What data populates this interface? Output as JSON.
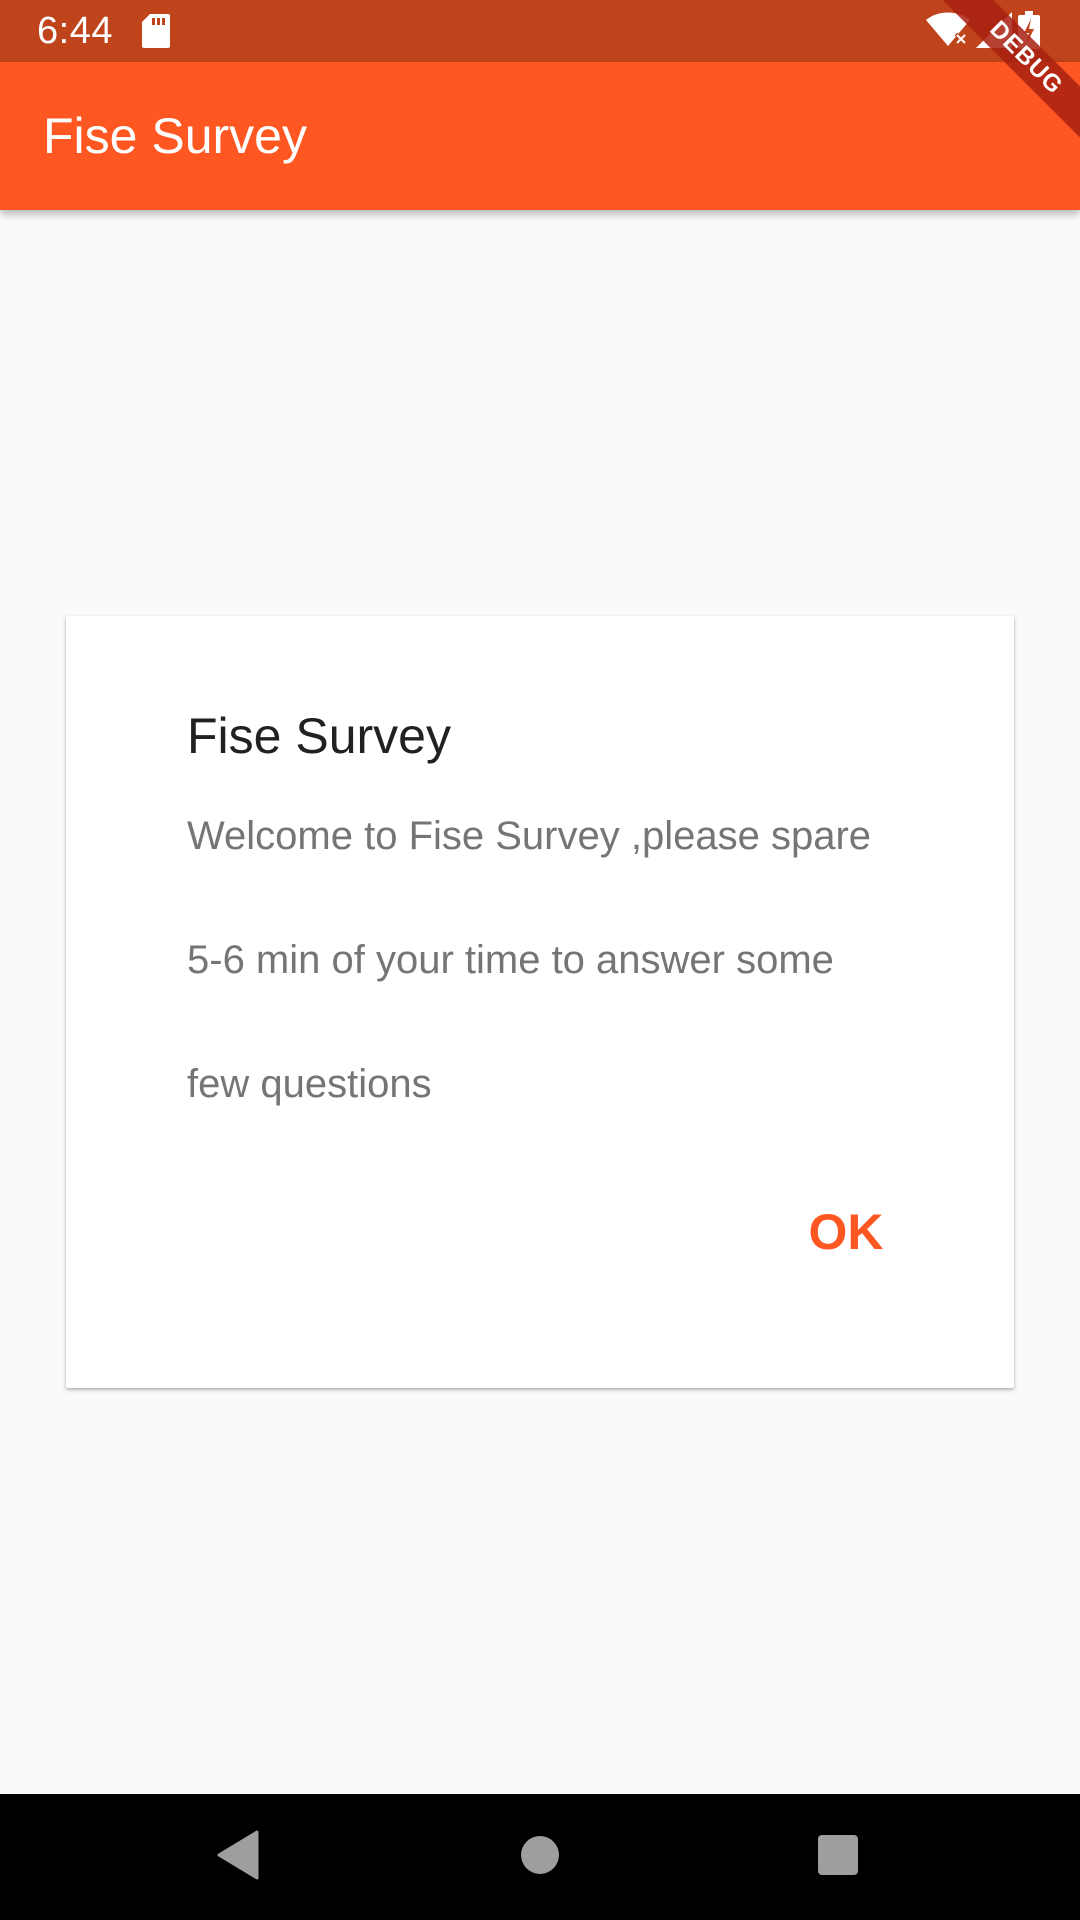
{
  "status_bar": {
    "time": "6:44",
    "icons": [
      "sd-card-icon",
      "wifi-icon",
      "signal-icon",
      "battery-icon"
    ]
  },
  "debug_banner": {
    "label": "DEBUG"
  },
  "app_bar": {
    "title": "Fise Survey",
    "color": "#ff5722"
  },
  "dialog": {
    "title": "Fise Survey",
    "message_lines": [
      "Welcome to Fise Survey ,please spare",
      "5-6 min of your time to answer some",
      "few questions"
    ],
    "ok_label": "OK",
    "accent_color": "#ff5722"
  },
  "nav_bar": {
    "buttons": [
      "back-icon",
      "home-icon",
      "recents-icon"
    ]
  }
}
